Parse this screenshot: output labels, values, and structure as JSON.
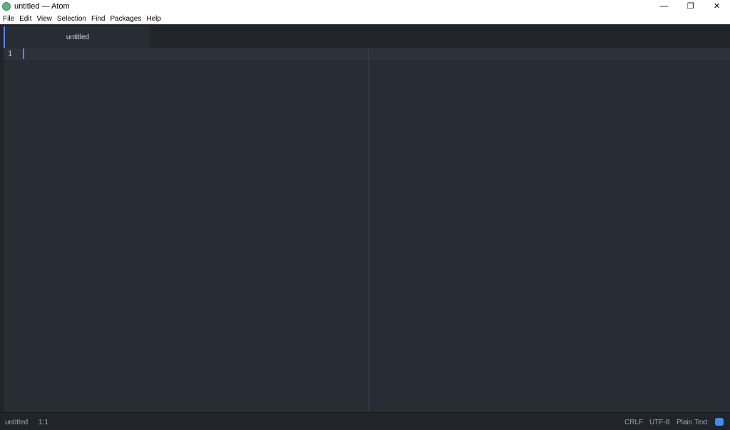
{
  "window": {
    "title": "untitled — Atom",
    "controls": {
      "minimize": "—",
      "restore": "❐",
      "close": "✕"
    }
  },
  "menu": [
    "File",
    "Edit",
    "View",
    "Selection",
    "Find",
    "Packages",
    "Help"
  ],
  "tabs": [
    {
      "label": "untitled",
      "active": true
    }
  ],
  "editor": {
    "line_numbers": [
      "1"
    ],
    "content": ""
  },
  "status": {
    "file": "untitled",
    "position": "1:1",
    "line_ending": "CRLF",
    "encoding": "UTF-8",
    "grammar": "Plain Text",
    "icon": "squirrel-update-icon"
  },
  "colors": {
    "accent": "#568af2",
    "background": "#282c34"
  }
}
